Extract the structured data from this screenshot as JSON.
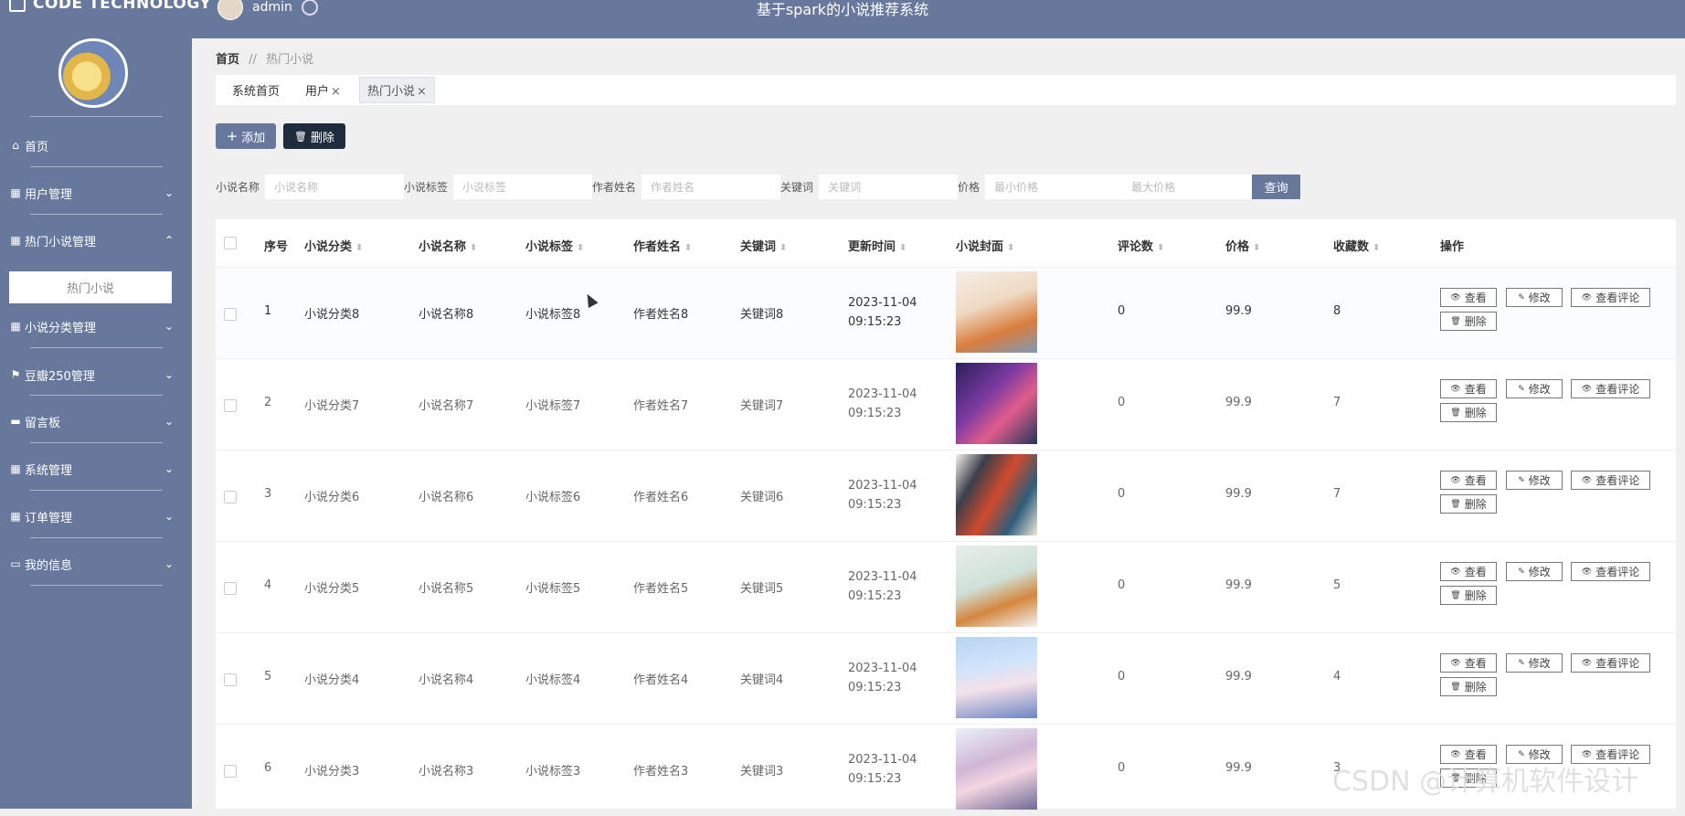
{
  "app": {
    "brand": "CODE TECHNOLOGY",
    "user": "admin",
    "title": "基于spark的小说推荐系统"
  },
  "sidebar": {
    "items": [
      {
        "label": "首页",
        "icon": "home-icon"
      },
      {
        "label": "用户管理",
        "icon": "grid-icon"
      },
      {
        "label": "热门小说管理",
        "icon": "grid-icon"
      },
      {
        "label": "小说分类管理",
        "icon": "grid-icon"
      },
      {
        "label": "豆瓣250管理",
        "icon": "flag-icon"
      },
      {
        "label": "留言板",
        "icon": "message-icon"
      },
      {
        "label": "系统管理",
        "icon": "grid-icon"
      },
      {
        "label": "订单管理",
        "icon": "grid-icon"
      },
      {
        "label": "我的信息",
        "icon": "card-icon"
      }
    ],
    "sub_item": "热门小说"
  },
  "breadcrumb": {
    "home": "首页",
    "separator": "//",
    "current": "热门小说"
  },
  "tabs": [
    {
      "label": "系统首页",
      "closable": false
    },
    {
      "label": "用户",
      "closable": true
    },
    {
      "label": "热门小说",
      "closable": true
    }
  ],
  "toolbar": {
    "add_label": "添加",
    "delete_label": "删除"
  },
  "search": {
    "fields": [
      {
        "label": "小说名称",
        "placeholder": "小说名称"
      },
      {
        "label": "小说标签",
        "placeholder": "小说标签"
      },
      {
        "label": "作者姓名",
        "placeholder": "作者姓名"
      },
      {
        "label": "关键词",
        "placeholder": "关键词"
      }
    ],
    "price_label": "价格",
    "min_placeholder": "最小价格",
    "max_placeholder": "最大价格",
    "query_label": "查询"
  },
  "table": {
    "headers": [
      "序号",
      "小说分类",
      "小说名称",
      "小说标签",
      "作者姓名",
      "关键词",
      "更新时间",
      "小说封面",
      "评论数",
      "价格",
      "收藏数",
      "操作"
    ],
    "actions": {
      "view": "查看",
      "edit": "修改",
      "view_comments": "查看评论",
      "delete": "删除"
    },
    "rows": [
      {
        "no": "1",
        "category": "小说分类8",
        "name": "小说名称8",
        "tag": "小说标签8",
        "author": "作者姓名8",
        "keyword": "关键词8",
        "time": "2023-11-04 09:15:23",
        "comments": "0",
        "price": "99.9",
        "favorites": "8"
      },
      {
        "no": "2",
        "category": "小说分类7",
        "name": "小说名称7",
        "tag": "小说标签7",
        "author": "作者姓名7",
        "keyword": "关键词7",
        "time": "2023-11-04 09:15:23",
        "comments": "0",
        "price": "99.9",
        "favorites": "7"
      },
      {
        "no": "3",
        "category": "小说分类6",
        "name": "小说名称6",
        "tag": "小说标签6",
        "author": "作者姓名6",
        "keyword": "关键词6",
        "time": "2023-11-04 09:15:23",
        "comments": "0",
        "price": "99.9",
        "favorites": "7"
      },
      {
        "no": "4",
        "category": "小说分类5",
        "name": "小说名称5",
        "tag": "小说标签5",
        "author": "作者姓名5",
        "keyword": "关键词5",
        "time": "2023-11-04 09:15:23",
        "comments": "0",
        "price": "99.9",
        "favorites": "5"
      },
      {
        "no": "5",
        "category": "小说分类4",
        "name": "小说名称4",
        "tag": "小说标签4",
        "author": "作者姓名4",
        "keyword": "关键词4",
        "time": "2023-11-04 09:15:23",
        "comments": "0",
        "price": "99.9",
        "favorites": "4"
      },
      {
        "no": "6",
        "category": "小说分类3",
        "name": "小说名称3",
        "tag": "小说标签3",
        "author": "作者姓名3",
        "keyword": "关键词3",
        "time": "2023-11-04 09:15:23",
        "comments": "0",
        "price": "99.9",
        "favorites": "3"
      }
    ]
  },
  "watermark": "CSDN @计算机软件设计",
  "colors": {
    "accent": "#67789c",
    "dark_button": "#1f2c3e"
  }
}
